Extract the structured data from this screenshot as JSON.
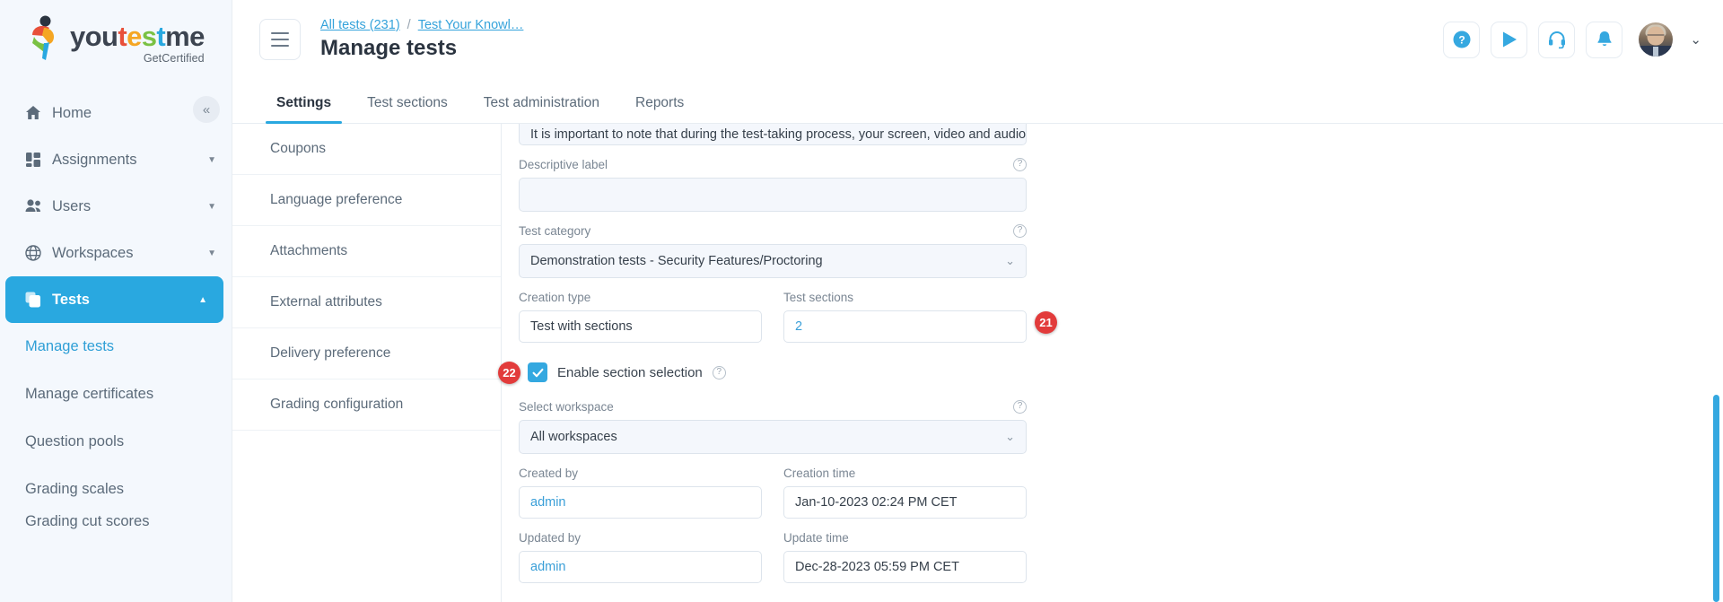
{
  "brand": {
    "word_parts": [
      {
        "text": "you",
        "color": "#3c4450"
      },
      {
        "text": "t",
        "color": "#e8503a"
      },
      {
        "text": "e",
        "color": "#f5a623"
      },
      {
        "text": "s",
        "color": "#7ac143"
      },
      {
        "text": "t",
        "color": "#29a8e0"
      },
      {
        "text": "me",
        "color": "#3c4450"
      }
    ],
    "name": "youtestme",
    "tagline": "GetCertified"
  },
  "colors": {
    "accent": "#29a8e0",
    "sidebar_bg": "#f4f8fd",
    "badge_red": "#e23b3b",
    "link_blue": "#35a3db",
    "text_dark": "#2b3440",
    "text_muted": "#5c6b7a"
  },
  "sidebar": {
    "collapse_icon": "«",
    "items": [
      {
        "label": "Home",
        "icon": "home-icon",
        "expandable": false,
        "active": false
      },
      {
        "label": "Assignments",
        "icon": "assignments-icon",
        "expandable": true,
        "active": false
      },
      {
        "label": "Users",
        "icon": "users-icon",
        "expandable": true,
        "active": false
      },
      {
        "label": "Workspaces",
        "icon": "globe-icon",
        "expandable": true,
        "active": false
      },
      {
        "label": "Tests",
        "icon": "tests-icon",
        "expandable": true,
        "active": true
      }
    ],
    "sub_items": [
      {
        "label": "Manage tests",
        "selected": true
      },
      {
        "label": "Manage certificates",
        "selected": false
      },
      {
        "label": "Question pools",
        "selected": false
      },
      {
        "label": "Grading scales",
        "selected": false
      },
      {
        "label": "Grading cut scores",
        "selected": false
      }
    ]
  },
  "header": {
    "menu_icon": "hamburger-icon",
    "breadcrumb": [
      {
        "label": "All tests (231)",
        "link": true
      },
      {
        "label": "/",
        "link": false
      },
      {
        "label": "Test Your Knowl…",
        "link": true
      }
    ],
    "title": "Manage tests",
    "actions": [
      {
        "name": "help-icon",
        "glyph": "?"
      },
      {
        "name": "play-icon",
        "glyph": "▶"
      },
      {
        "name": "support-headset-icon",
        "glyph": "headset"
      },
      {
        "name": "notifications-bell-icon",
        "glyph": "bell"
      }
    ],
    "avatar_chevron": "⌄"
  },
  "tabs": [
    {
      "label": "Settings",
      "active": true
    },
    {
      "label": "Test sections",
      "active": false
    },
    {
      "label": "Test administration",
      "active": false
    },
    {
      "label": "Reports",
      "active": false
    }
  ],
  "inner_menu": [
    {
      "label": "Coupons"
    },
    {
      "label": "Language preference"
    },
    {
      "label": "Attachments"
    },
    {
      "label": "External attributes"
    },
    {
      "label": "Delivery preference"
    },
    {
      "label": "Grading configuration"
    }
  ],
  "form": {
    "description_snippet": "It is important to note that during the test-taking process, your screen, video and audio",
    "descriptive_label": {
      "label": "Descriptive label",
      "value": "",
      "help": "?"
    },
    "test_category": {
      "label": "Test category",
      "value": "Demonstration tests - Security Features/Proctoring",
      "help": "?",
      "caret": "⌄"
    },
    "creation_type": {
      "label": "Creation type",
      "value": "Test with sections"
    },
    "test_sections": {
      "label": "Test sections",
      "value": "2",
      "badge": "21"
    },
    "enable_section_selection": {
      "label": "Enable section selection",
      "checked": true,
      "badge": "22",
      "help": "?"
    },
    "select_workspace": {
      "label": "Select workspace",
      "value": "All workspaces",
      "help": "?",
      "caret": "⌄"
    },
    "created_by": {
      "label": "Created by",
      "value": "admin"
    },
    "creation_time": {
      "label": "Creation time",
      "value": "Jan-10-2023 02:24 PM CET"
    },
    "updated_by": {
      "label": "Updated by",
      "value": "admin"
    },
    "update_time": {
      "label": "Update time",
      "value": "Dec-28-2023 05:59 PM CET"
    }
  }
}
